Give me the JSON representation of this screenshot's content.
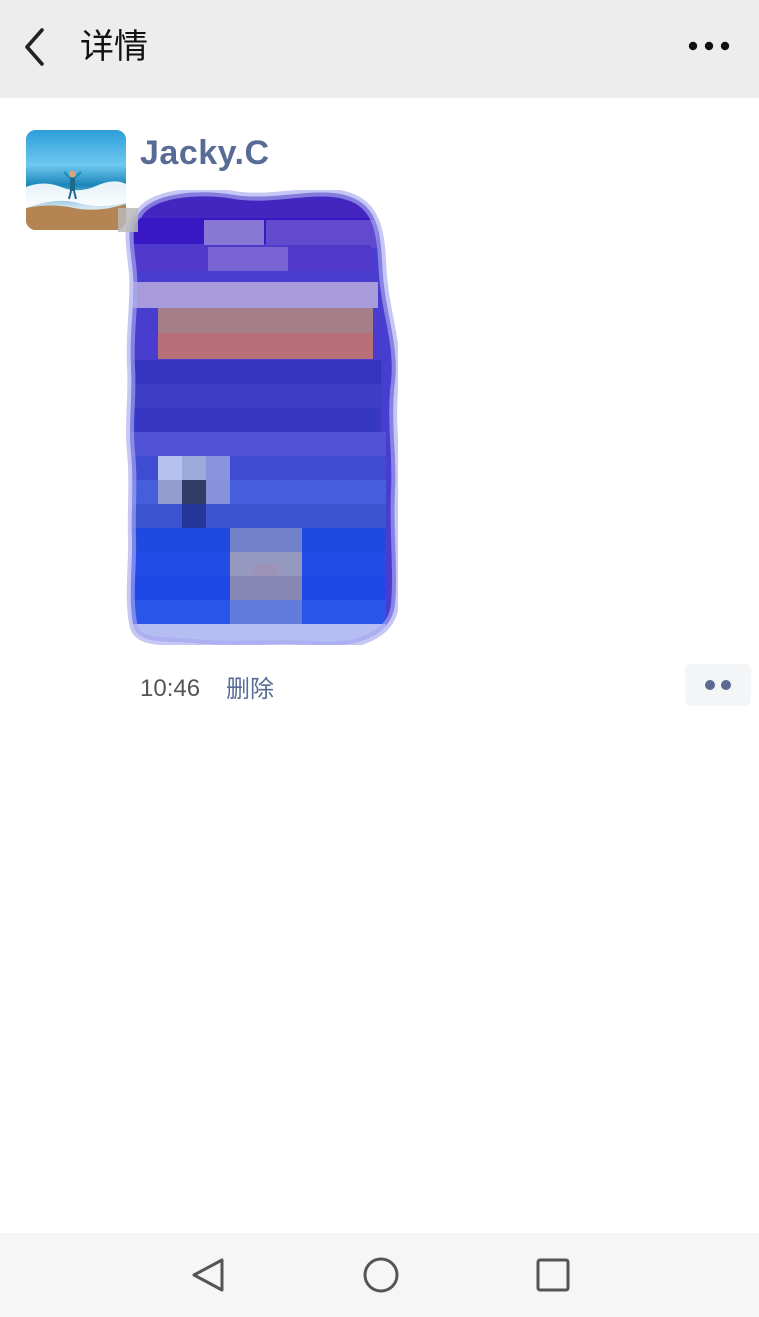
{
  "header": {
    "title": "详情",
    "back_icon": "back-arrow-icon",
    "more_icon": "more-dots-icon"
  },
  "post": {
    "author": "Jacky.C",
    "time": "10:46",
    "delete_label": "删除",
    "avatar_icon": "beach-avatar",
    "image_state": "pixelated",
    "action_icon": "comment-like-dots-icon",
    "colors": {
      "link": "#576b95",
      "topbar": "#ededed",
      "navbar": "#f6f6f6"
    }
  },
  "system_nav": {
    "buttons": [
      "back-triangle-icon",
      "home-circle-icon",
      "recent-square-icon"
    ]
  }
}
